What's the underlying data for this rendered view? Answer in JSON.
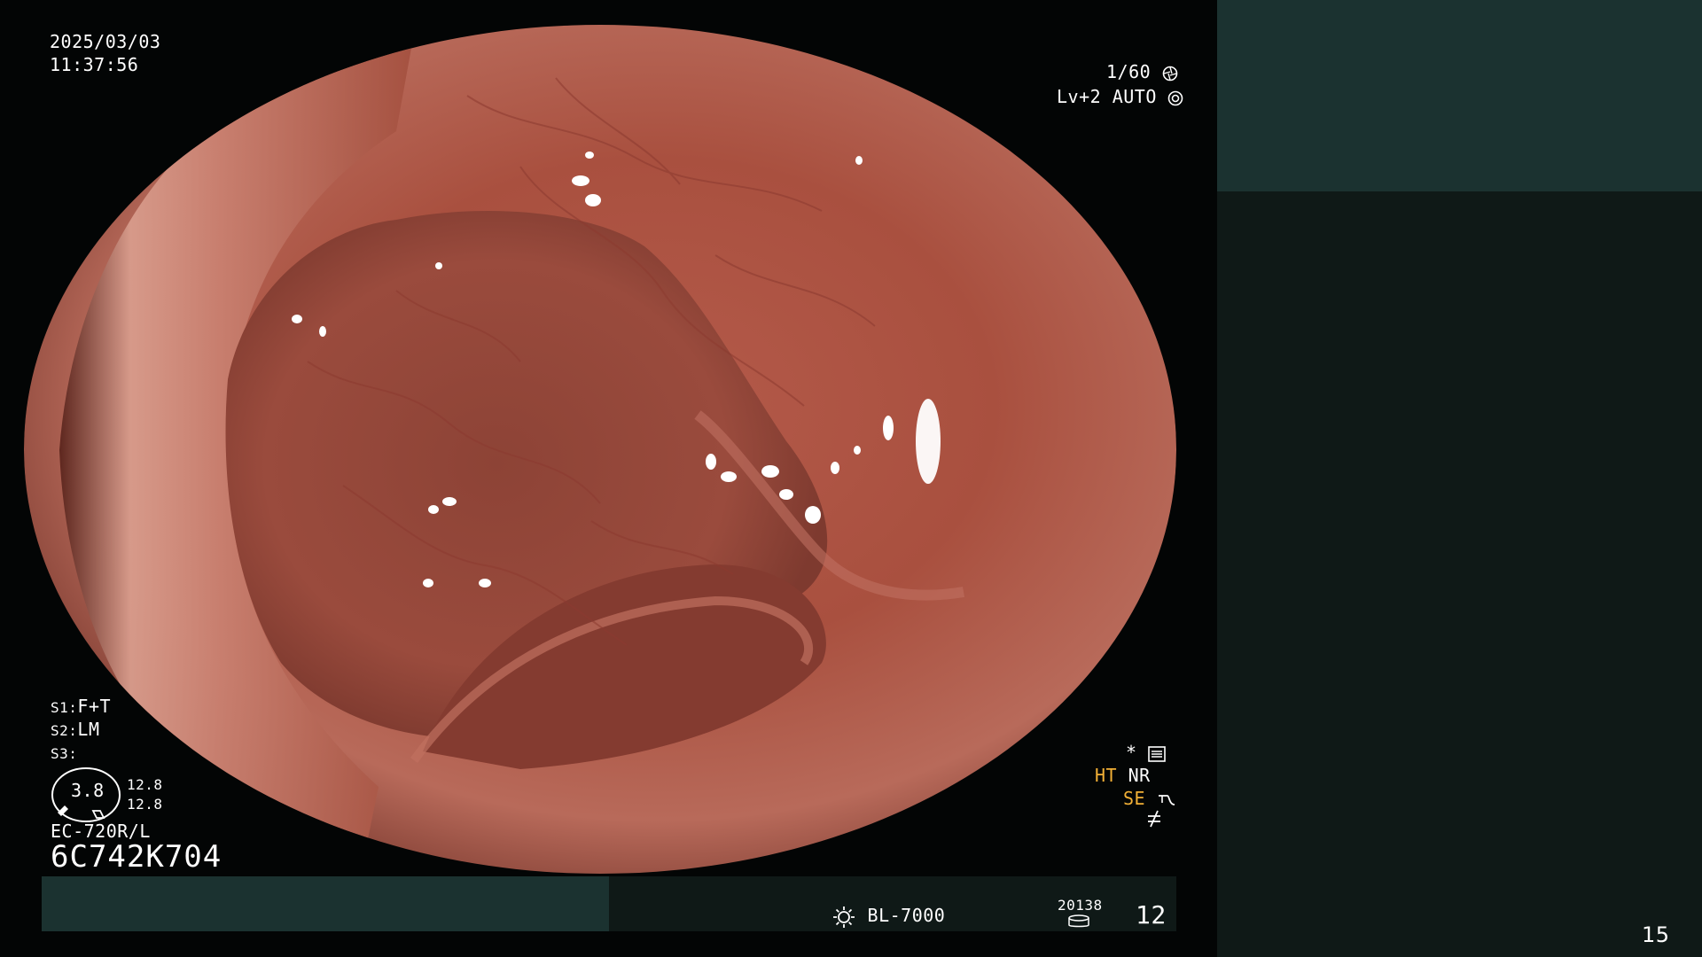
{
  "overlay": {
    "date": "2025/03/03",
    "time": "11:37:56",
    "shutter": "1/60",
    "level": "Lv+2",
    "iris": "AUTO",
    "s1": "F+T",
    "s2": "LM",
    "s3": "",
    "s1_label": "S1:",
    "s2_label": "S2:",
    "s3_label": "S3:",
    "dial_value": "3.8",
    "dial_side_top": "12.8",
    "dial_side_bottom": "12.8",
    "scope_model": "EC-720R/L",
    "serial": "6C742K704",
    "asterisk": "*",
    "ht": "HT",
    "nr": "NR",
    "se": "SE",
    "light_source": "BL-7000",
    "storage_count": "20138",
    "frame_number": "12",
    "page_number": "15"
  },
  "colors": {
    "accent_orange": "#f2b036",
    "panel_teal": "#1b3230",
    "panel_dark": "#0f1917"
  },
  "icons": {
    "shutter_icon": "aperture-icon",
    "iris_icon": "iris-icon",
    "settings_icon": "settings-list-icon",
    "se_icon": "enhance-curve-icon",
    "freeze_icon": "not-equal-icon",
    "light_icon": "sun-icon",
    "storage_icon": "database-icon"
  }
}
